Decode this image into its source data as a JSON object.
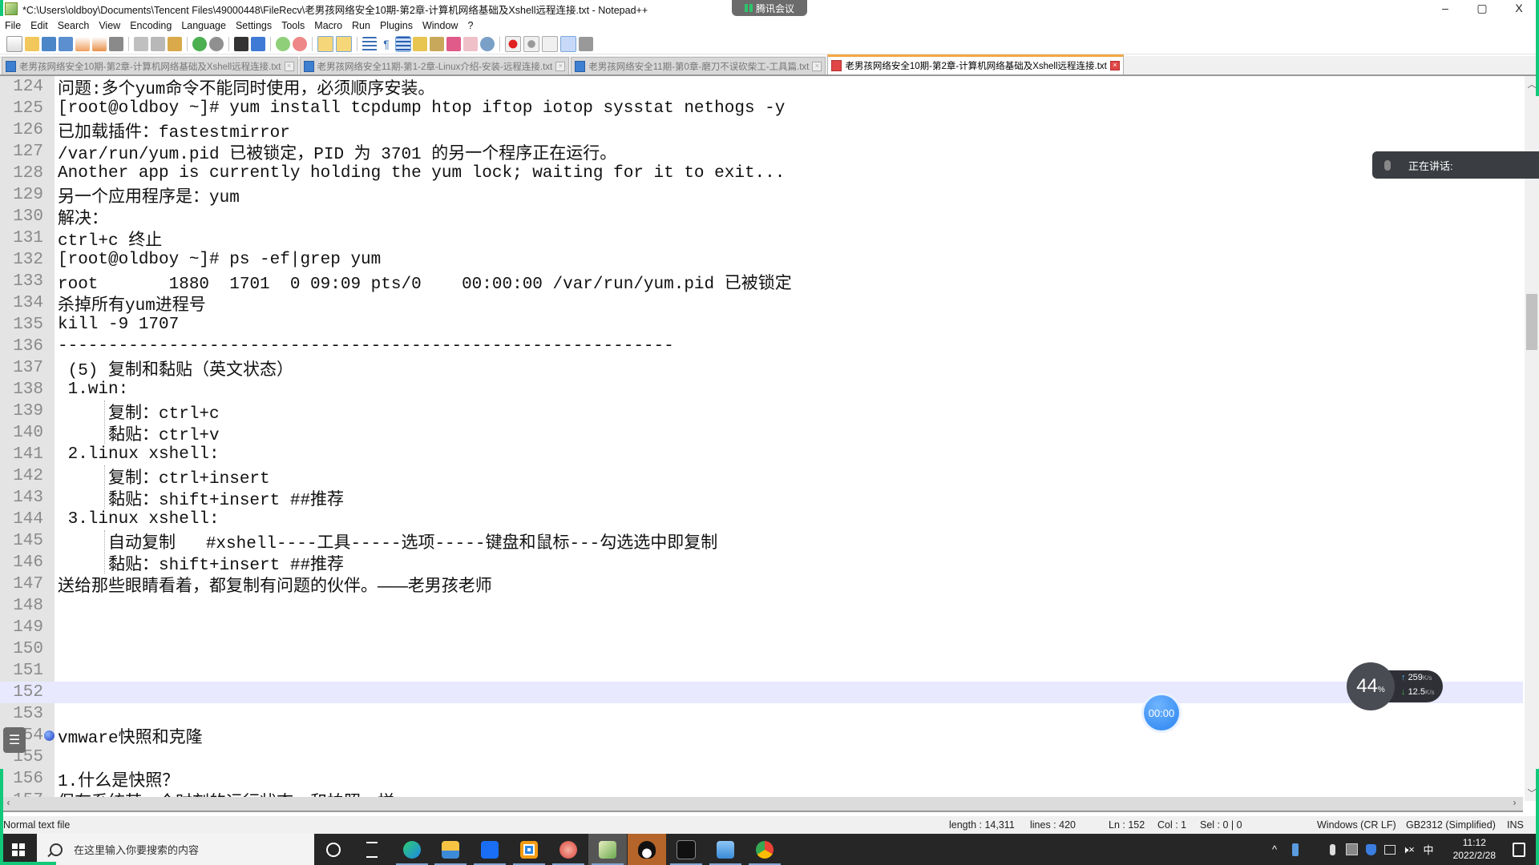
{
  "window": {
    "title": "*C:\\Users\\oldboy\\Documents\\Tencent Files\\49000448\\FileRecv\\老男孩网络安全10期-第2章-计算机网络基础及Xshell远程连接.txt - Notepad++",
    "meeting_indicator": "腾讯会议",
    "minimize": "–",
    "restore": "▢",
    "close": "X",
    "doc_close": "X"
  },
  "menu": [
    "File",
    "Edit",
    "Search",
    "View",
    "Encoding",
    "Language",
    "Settings",
    "Tools",
    "Macro",
    "Run",
    "Plugins",
    "Window",
    "?"
  ],
  "toolbar": {
    "buttons": [
      "new-file",
      "open-file",
      "save",
      "save-all",
      "close",
      "close-all",
      "print",
      "cut",
      "copy",
      "paste",
      "undo",
      "redo",
      "find",
      "replace",
      "zoom-in",
      "zoom-out",
      "sync-vertical",
      "sync-horizontal",
      "word-wrap",
      "show-all-chars",
      "indent-guide",
      "function-list",
      "document-map",
      "doc-list",
      "folder-as-workspace",
      "monitoring",
      "record-macro",
      "stop-record",
      "play-macro",
      "run-macro-multiple",
      "save-macro"
    ],
    "active": "indent-guide"
  },
  "tabs": [
    {
      "label": "老男孩网络安全10期-第2章-计算机网络基础及Xshell远程连接.txt",
      "active": false
    },
    {
      "label": "老男孩网络安全11期-第1-2章-Linux介绍-安装-远程连接.txt",
      "active": false
    },
    {
      "label": "老男孩网络安全11期-第0章-磨刀不误砍柴工-工具篇.txt",
      "active": false
    },
    {
      "label": "老男孩网络安全10期-第2章-计算机网络基础及Xshell远程连接.txt",
      "active": true
    }
  ],
  "editor": {
    "current_line": 152,
    "bookmark_line": 154,
    "lines": [
      {
        "n": 124,
        "text": "问题:多个yum命令不能同时使用，必须顺序安装。"
      },
      {
        "n": 125,
        "text": "[root@oldboy ~]# yum install tcpdump htop iftop iotop sysstat nethogs -y"
      },
      {
        "n": 126,
        "text": "已加载插件：fastestmirror"
      },
      {
        "n": 127,
        "text": "/var/run/yum.pid 已被锁定，PID 为 3701 的另一个程序正在运行。"
      },
      {
        "n": 128,
        "text": "Another app is currently holding the yum lock; waiting for it to exit..."
      },
      {
        "n": 129,
        "text": "另一个应用程序是：yum"
      },
      {
        "n": 130,
        "text": "解决："
      },
      {
        "n": 131,
        "text": "ctrl+c 终止"
      },
      {
        "n": 132,
        "text": "[root@oldboy ~]# ps -ef|grep yum"
      },
      {
        "n": 133,
        "text": "root       1880  1701  0 09:09 pts/0    00:00:00 /var/run/yum.pid 已被锁定"
      },
      {
        "n": 134,
        "text": "杀掉所有yum进程号"
      },
      {
        "n": 135,
        "text": "kill -9 1707"
      },
      {
        "n": 136,
        "text": "-------------------------------------------------------------"
      },
      {
        "n": 137,
        "text": " (5) 复制和黏贴（英文状态）"
      },
      {
        "n": 138,
        "text": " 1.win:"
      },
      {
        "n": 139,
        "text": "     复制：ctrl+c"
      },
      {
        "n": 140,
        "text": "     黏贴：ctrl+v"
      },
      {
        "n": 141,
        "text": " 2.linux xshell:"
      },
      {
        "n": 142,
        "text": "     复制：ctrl+insert"
      },
      {
        "n": 143,
        "text": "     黏贴：shift+insert ##推荐"
      },
      {
        "n": 144,
        "text": " 3.linux xshell:"
      },
      {
        "n": 145,
        "text": "     自动复制   #xshell----工具-----选项-----键盘和鼠标---勾选选中即复制"
      },
      {
        "n": 146,
        "text": "     黏贴：shift+insert ##推荐"
      },
      {
        "n": 147,
        "text": "送给那些眼睛看着，都复制有问题的伙伴。———老男孩老师"
      },
      {
        "n": 148,
        "text": ""
      },
      {
        "n": 149,
        "text": ""
      },
      {
        "n": 150,
        "text": ""
      },
      {
        "n": 151,
        "text": ""
      },
      {
        "n": 152,
        "text": ""
      },
      {
        "n": 153,
        "text": ""
      },
      {
        "n": 154,
        "text": "vmware快照和克隆"
      },
      {
        "n": 155,
        "text": ""
      },
      {
        "n": 156,
        "text": "1.什么是快照？"
      },
      {
        "n": 157,
        "text": "保存系统某一个时刻的运行状态，和拍照一样"
      }
    ]
  },
  "statusbar": {
    "file_type": "Normal text file",
    "length": "length : 14,311",
    "lines": "lines : 420",
    "ln": "Ln : 152",
    "col": "Col : 1",
    "sel": "Sel : 0 | 0",
    "eol": "Windows (CR LF)",
    "encoding": "GB2312 (Simplified)",
    "mode": "INS"
  },
  "overlays": {
    "speaking_label": "正在讲话:",
    "timer": "00:00",
    "cpu_percent": "44",
    "percent_sign": "%",
    "upload_rate": "259",
    "download_rate": "12.5",
    "rate_unit": "K/s",
    "outline_icon": "☰"
  },
  "taskbar": {
    "search_placeholder": "在这里输入你要搜索的内容",
    "apps": [
      "cortana",
      "task-view",
      "edge",
      "file-explorer",
      "feishu",
      "vmware",
      "snail-app",
      "notepad-plus-plus",
      "qq",
      "terminal",
      "remote-desktop",
      "chrome"
    ],
    "tray": {
      "ime": "中",
      "volume": "🕨×"
    },
    "time": "11:12",
    "date": "2022/2/28"
  }
}
